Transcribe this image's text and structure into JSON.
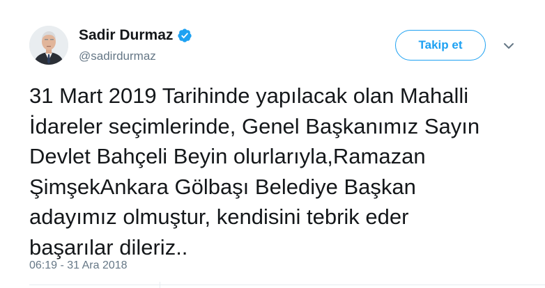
{
  "author": {
    "display_name": "Sadir Durmaz",
    "handle": "@sadirdurmaz",
    "verified": true
  },
  "follow_button_label": "Takip et",
  "icons": {
    "verified": "verified-badge-icon",
    "caret": "chevron-down-icon"
  },
  "tweet": {
    "text": "31 Mart 2019 Tarihinde yapılacak olan Mahalli\nİdareler seçimlerinde, Genel Başkanımız Sayın\nDevlet Bahçeli Beyin olurlarıyla,Ramazan\nŞimşekAnkara Gölbaşı Belediye Başkan\nadayımız olmuştur, kendisini tebrik eder\nbaşarılar dileriz..",
    "timestamp": "06:19 - 31 Ara 2018"
  },
  "colors": {
    "accent": "#1da1f2",
    "text": "#14171a",
    "muted": "#657786",
    "border": "#e6ecf0"
  }
}
